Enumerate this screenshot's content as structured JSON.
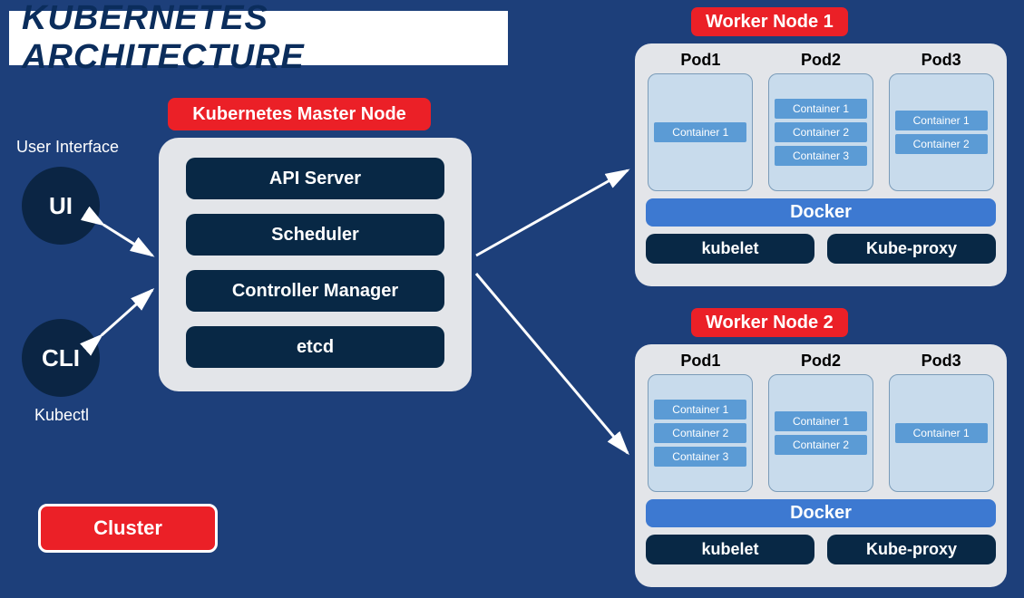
{
  "title": "KUBERNETES ARCHITECTURE",
  "ui_label": "User Interface",
  "ui_circle": "UI",
  "cli_circle": "CLI",
  "cli_label": "Kubectl",
  "master_title": "Kubernetes Master Node",
  "master": {
    "api": "API Server",
    "sched": "Scheduler",
    "ctrl": "Controller Manager",
    "etcd": "etcd"
  },
  "cluster": "Cluster",
  "worker1": {
    "title": "Worker Node 1",
    "pods": [
      {
        "label": "Pod1",
        "containers": [
          "Container 1"
        ]
      },
      {
        "label": "Pod2",
        "containers": [
          "Container 1",
          "Container 2",
          "Container 3"
        ]
      },
      {
        "label": "Pod3",
        "containers": [
          "Container 1",
          "Container 2"
        ]
      }
    ],
    "docker": "Docker",
    "kubelet": "kubelet",
    "kubeproxy": "Kube-proxy"
  },
  "worker2": {
    "title": "Worker Node 2",
    "pods": [
      {
        "label": "Pod1",
        "containers": [
          "Container 1",
          "Container 2",
          "Container 3"
        ]
      },
      {
        "label": "Pod2",
        "containers": [
          "Container 1",
          "Container 2"
        ]
      },
      {
        "label": "Pod3",
        "containers": [
          "Container 1"
        ]
      }
    ],
    "docker": "Docker",
    "kubelet": "kubelet",
    "kubeproxy": "Kube-proxy"
  }
}
